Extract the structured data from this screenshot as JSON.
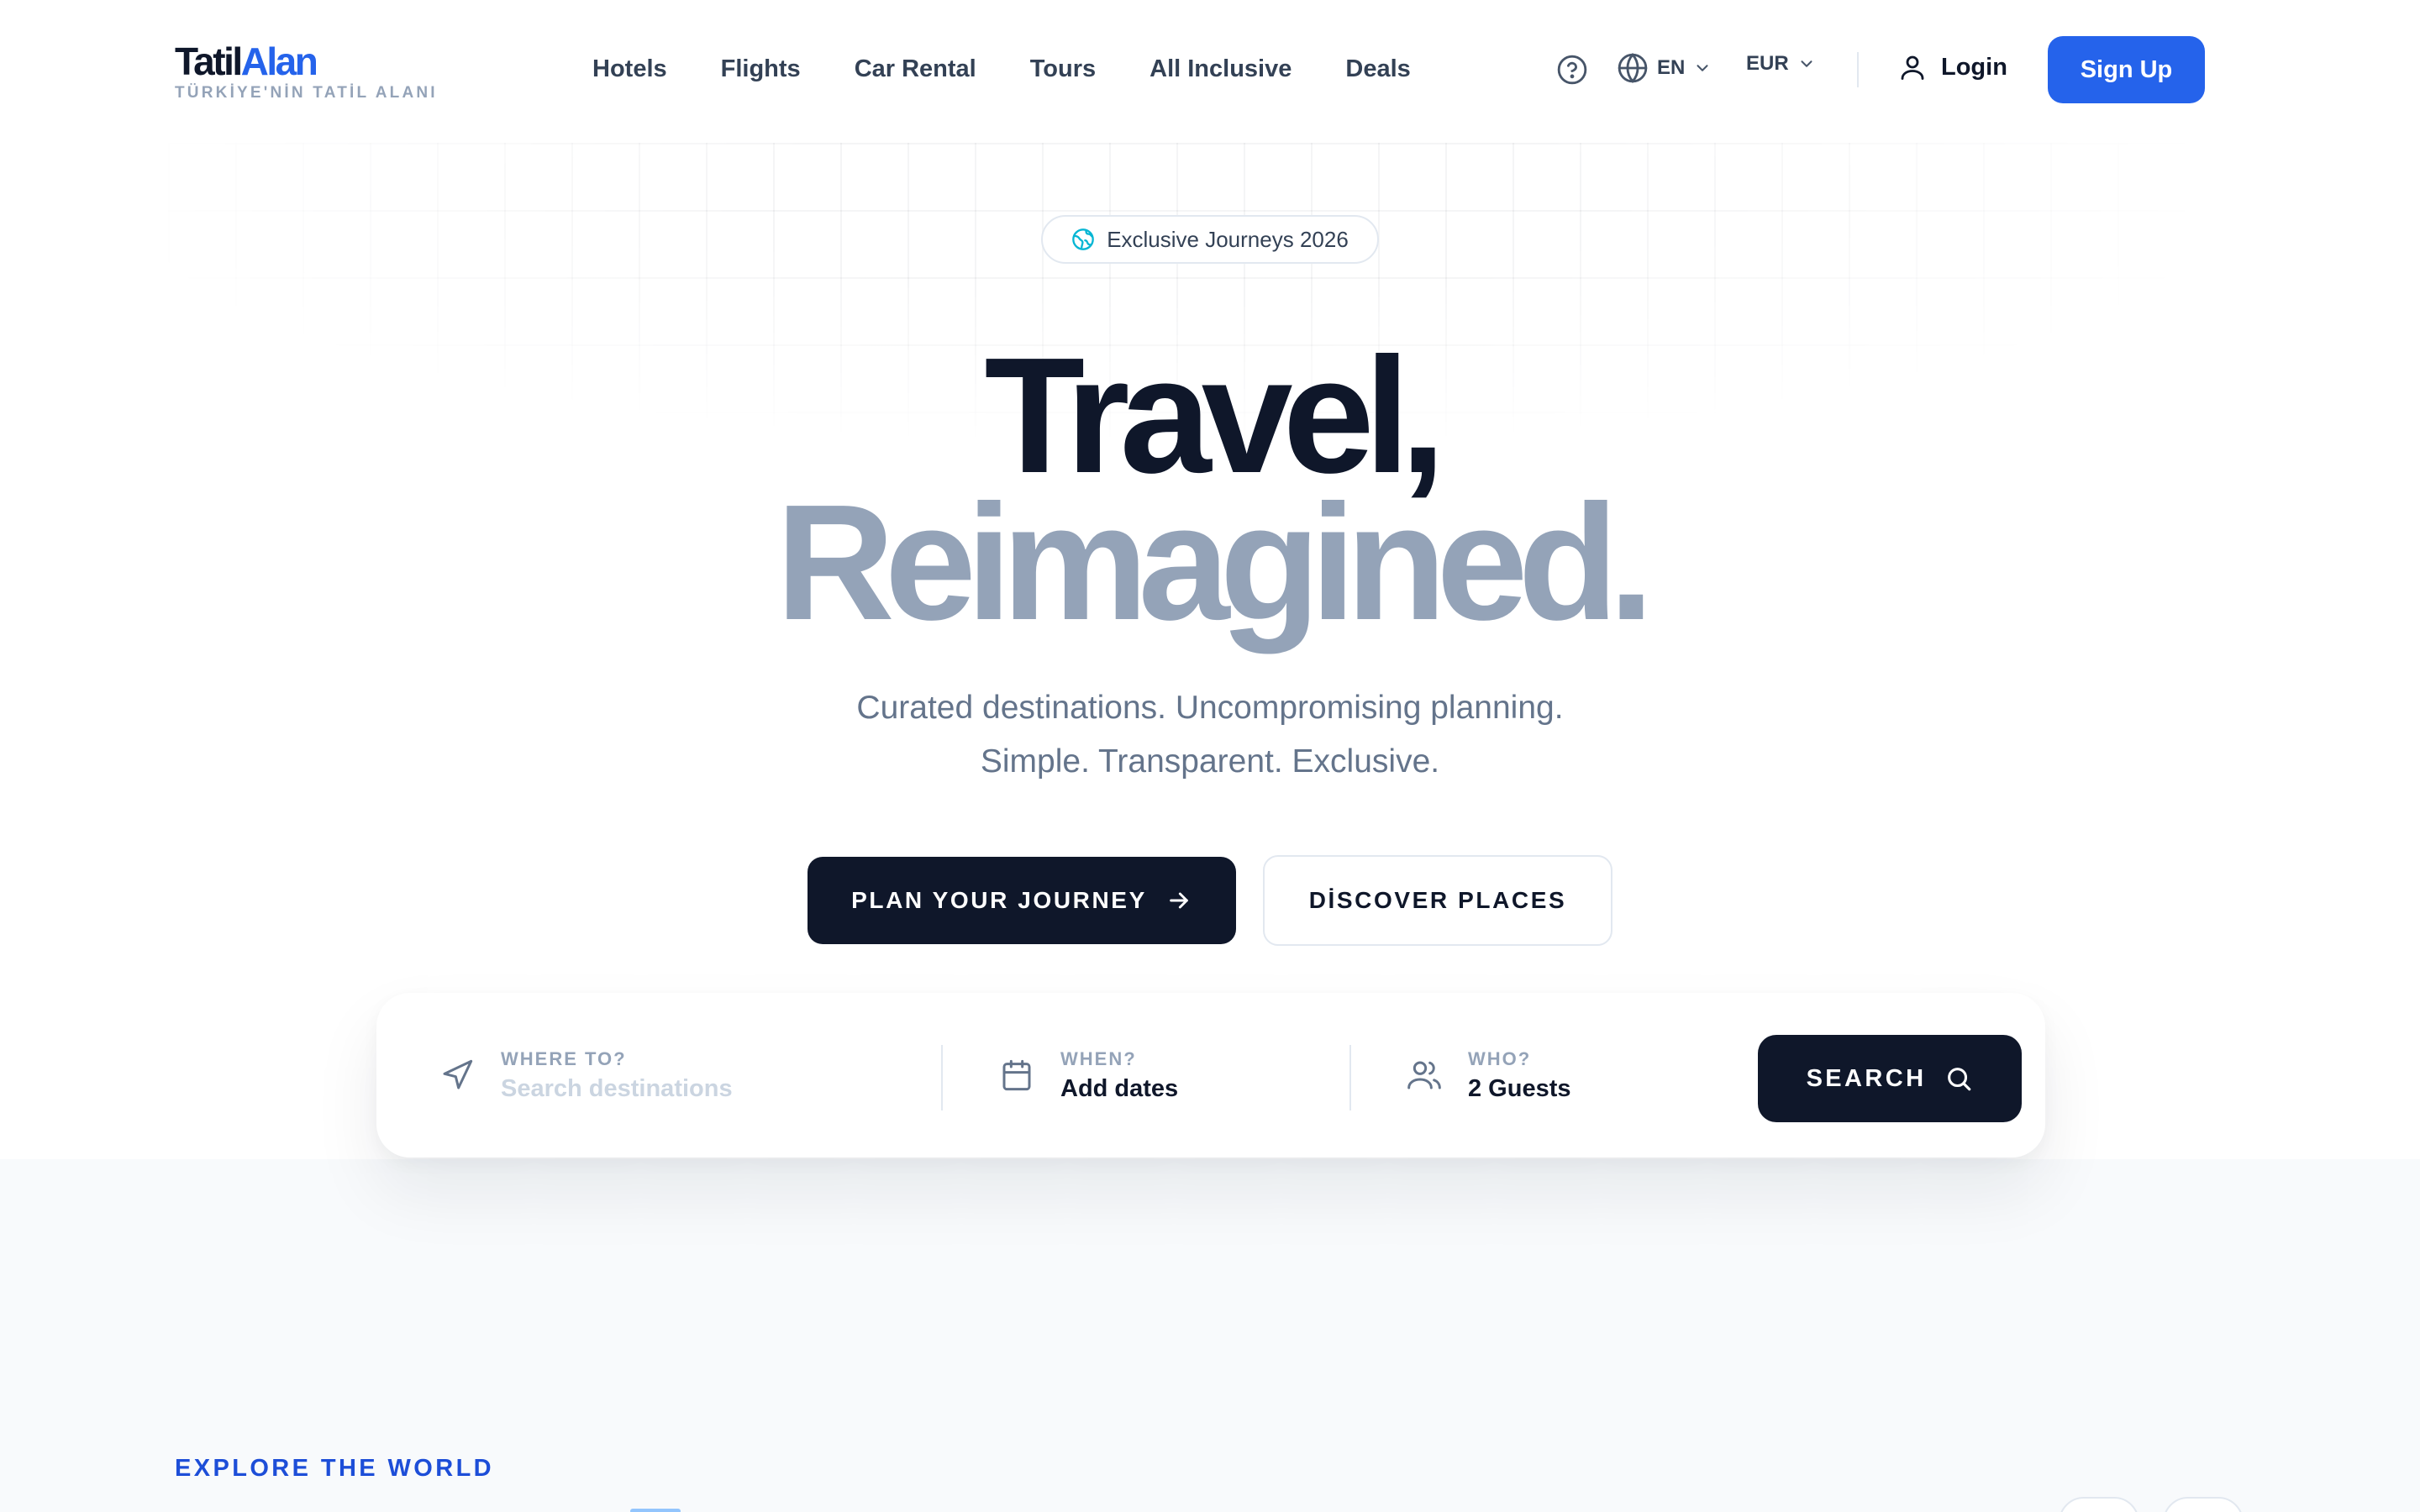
{
  "brand": {
    "name_part1": "Tatil",
    "name_part2": "Alan",
    "tagline": "TÜRKİYE'NİN TATİL ALANI",
    "accent_color": "#2563eb"
  },
  "nav": {
    "items": [
      {
        "label": "Hotels"
      },
      {
        "label": "Flights"
      },
      {
        "label": "Car Rental"
      },
      {
        "label": "Tours"
      },
      {
        "label": "All Inclusive"
      },
      {
        "label": "Deals"
      }
    ]
  },
  "header_actions": {
    "help_icon": "help-circle-icon",
    "language": "EN",
    "currency": "EUR",
    "login_label": "Login",
    "signup_label": "Sign Up"
  },
  "hero": {
    "badge": "Exclusive Journeys 2026",
    "title_line1": "Travel,",
    "title_line2": "Reimagined.",
    "subtitle_line1": "Curated destinations. Uncompromising planning.",
    "subtitle_line2": "Simple. Transparent. Exclusive.",
    "primary_cta": "PLAN YOUR JOURNEY",
    "secondary_cta": "DİSCOVER PLACES"
  },
  "search": {
    "where": {
      "label": "WHERE TO?",
      "placeholder": "Search destinations"
    },
    "when": {
      "label": "WHEN?",
      "value": "Add dates"
    },
    "who": {
      "label": "WHO?",
      "value": "2 Guests"
    },
    "button_label": "SEARCH"
  },
  "section": {
    "eyebrow": "EXPLORE THE WORLD"
  },
  "colors": {
    "dark": "#0f172a",
    "muted_title": "#94a3b8",
    "section_eyebrow": "#1d4ed8"
  }
}
